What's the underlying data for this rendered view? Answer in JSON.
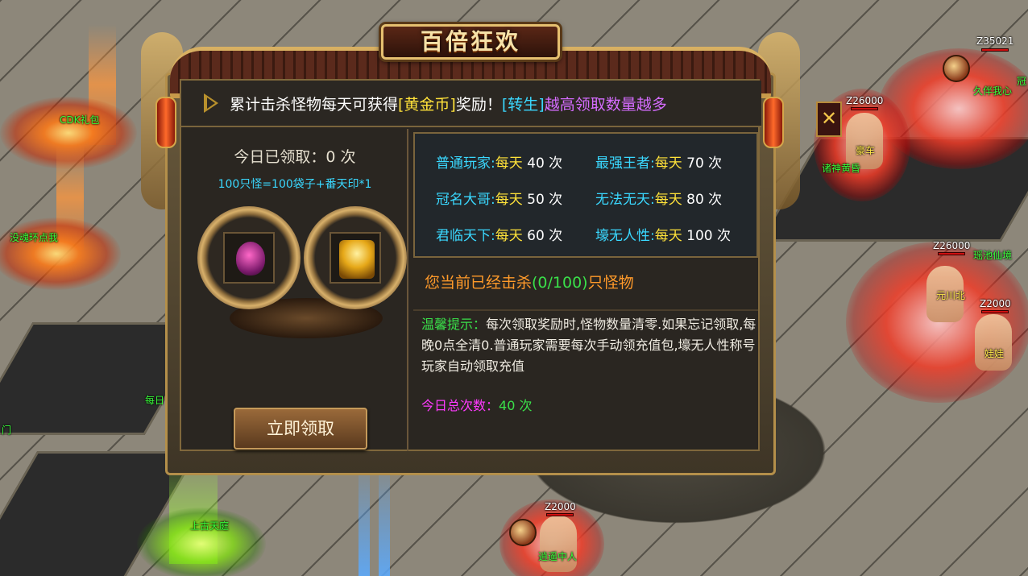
{
  "panel": {
    "title": "百倍狂欢",
    "banner": {
      "part1": "累计击杀怪物每天可获得",
      "part2": "[黄金币]",
      "part3": "奖励！",
      "part4": "[转生]",
      "part5": "越高领取数量越多"
    },
    "today_claimed": "今日已领取：0 次",
    "formula": "100只怪=100袋子+番天印*1",
    "claim_button": "立即领取",
    "close_icon": "✕",
    "tiers": [
      {
        "name": "普通玩家:",
        "per": "每天",
        "count": " 40 次"
      },
      {
        "name": "最强王者:",
        "per": "每天",
        "count": " 70 次"
      },
      {
        "name": "冠名大哥:",
        "per": "每天",
        "count": " 50 次"
      },
      {
        "name": "无法无天:",
        "per": "每天",
        "count": " 80 次"
      },
      {
        "name": "君临天下:",
        "per": "每天",
        "count": " 60 次"
      },
      {
        "name": "壕无人性:",
        "per": "每天",
        "count": " 100 次"
      }
    ],
    "kill_prefix": "您当前已经击杀",
    "kill_count": "(0/100)",
    "kill_suffix": "只怪物",
    "tip_label": "温馨提示：",
    "tip_body": "每次领取奖励时,怪物数量清零.如果忘记领取,每晚0点全清0.普通玩家需要每次手动领充值包,壕无人性称号玩家自动领取充值",
    "total_label": "今日总次数：",
    "total_value": "40 次"
  },
  "scene": {
    "labels": {
      "cdk": "CDK礼包",
      "hun": "没魂环点我",
      "daily": "每日",
      "men": "门",
      "shanggu": "上古天庭",
      "z35021": "Z35021",
      "jiuban": "久伴我心",
      "guan": "冠",
      "z26000a": "Z26000",
      "haoche": "豪车",
      "zhushen": "诸神黄昏",
      "z26000b": "Z26000",
      "yaochi": "瑶池仙境",
      "yuanchuan": "元川北",
      "z2000a": "Z2000",
      "wawa": "娃娃",
      "z2000b": "Z2000",
      "xiaoyao": "逍遥中人"
    }
  },
  "colors": {
    "cyan": "#3ad8ff",
    "yellow": "#ffe23a",
    "purple": "#d56cff",
    "green": "#3ae04a",
    "orange": "#ff9a2a",
    "magenta": "#ff3aff",
    "gold_frame": "#b48f4a"
  },
  "icons": [
    "reward-bag-icon",
    "fantian-seal-icon",
    "banner-arrow-icon",
    "close-icon"
  ]
}
